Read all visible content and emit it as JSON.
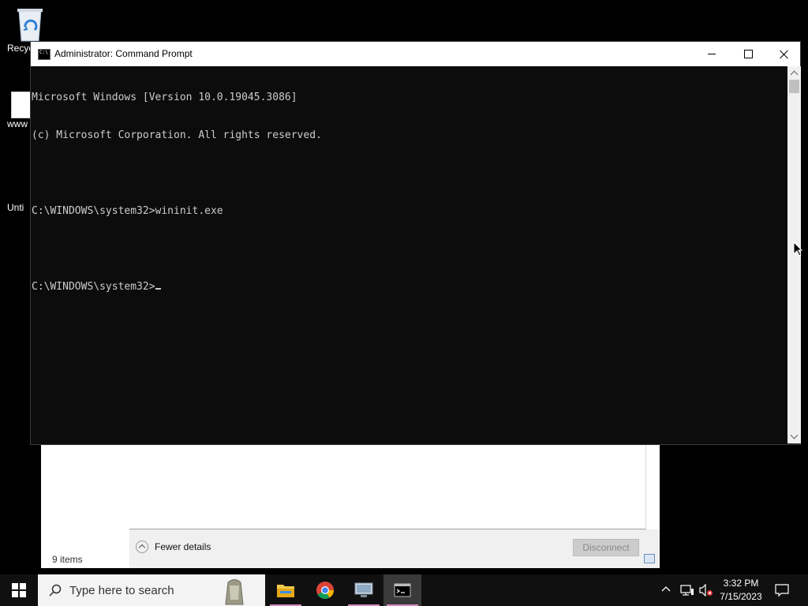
{
  "desktop": {
    "icons": [
      {
        "label": "Recyc"
      },
      {
        "label": "www"
      },
      {
        "label": "Unti"
      }
    ]
  },
  "explorer_window": {
    "item_count": "9 items",
    "fewer_details": "Fewer details",
    "disconnect_label": "Disconnect"
  },
  "cmd_window": {
    "title": "Administrator: Command Prompt",
    "lines": [
      "Microsoft Windows [Version 10.0.19045.3086]",
      "(c) Microsoft Corporation. All rights reserved.",
      "",
      "C:\\WINDOWS\\system32>wininit.exe",
      "",
      "C:\\WINDOWS\\system32>"
    ]
  },
  "taskbar": {
    "search_placeholder": "Type here to search",
    "apps": [
      "file-explorer-icon",
      "chrome-icon",
      "remote-desktop-icon",
      "command-prompt-icon"
    ],
    "clock_time": "3:32 PM",
    "clock_date": "7/15/2023"
  },
  "colors": {
    "console_bg": "#0c0c0c",
    "console_text": "#cccccc",
    "taskbar_bg": "#101010",
    "active_underline": "#d48bbd"
  }
}
